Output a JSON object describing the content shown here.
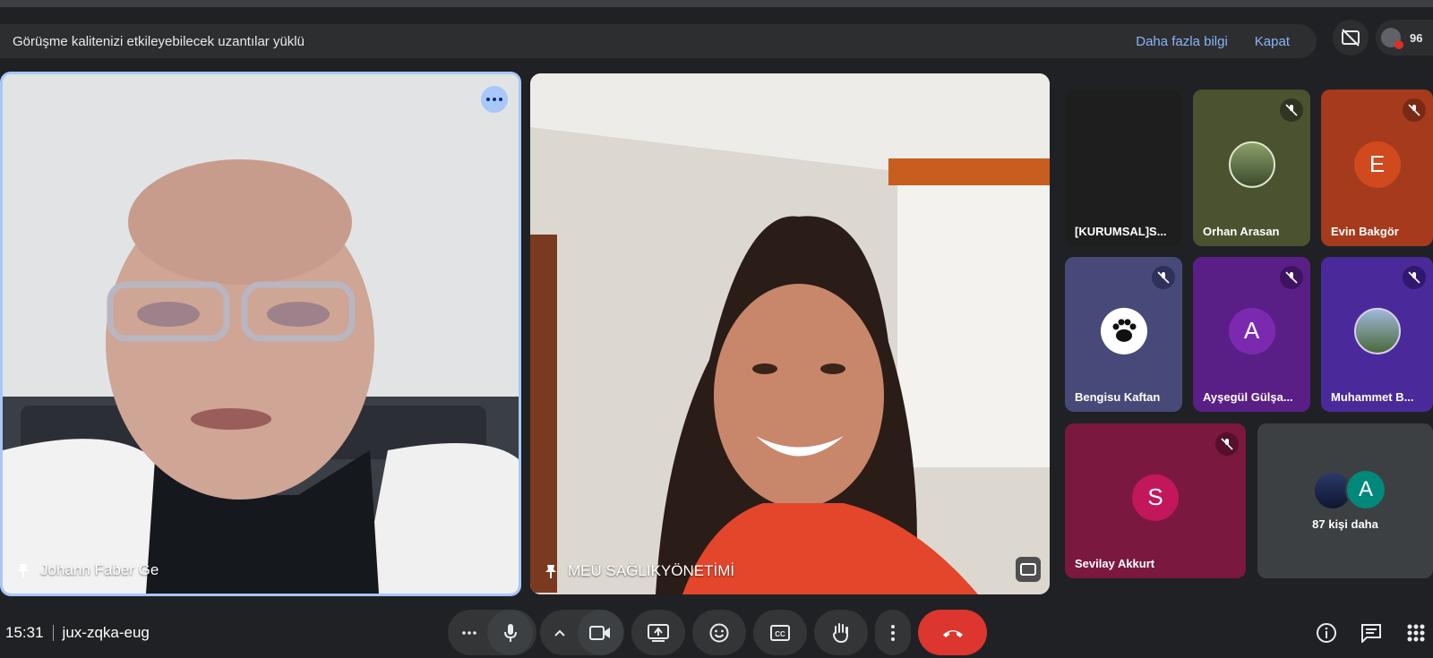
{
  "banner": {
    "message": "Görüşme kalitenizi etkileyebilecek uzantılar yüklü",
    "learn_more": "Daha fazla bilgi",
    "close": "Kapat"
  },
  "participants_count": "96",
  "main_tiles": [
    {
      "name": "Johann Faber Ge"
    },
    {
      "name": "MEÜ SAĞLIKYÖNETİMİ"
    }
  ],
  "grid": [
    {
      "name": "[KURUMSAL]S...",
      "bg": "#1e1e1f",
      "muted": false,
      "avatar": null
    },
    {
      "name": "Orhan Arasan",
      "bg": "#4a5230",
      "muted": true,
      "avatar": "photo"
    },
    {
      "name": "Evin Bakgör",
      "bg": "#a63a1c",
      "muted": true,
      "avatar": "E",
      "avatar_color": "#d04a1e"
    },
    {
      "name": "Bengisu Kaftan",
      "bg": "#474a78",
      "muted": true,
      "avatar": "paw"
    },
    {
      "name": "Ayşegül Gülşa...",
      "bg": "#5a1f86",
      "muted": true,
      "avatar": "A",
      "avatar_color": "#7b2ab0"
    },
    {
      "name": "Muhammet B...",
      "bg": "#4a2a9a",
      "muted": true,
      "avatar": "photo"
    },
    {
      "name": "Sevilay Akkurt",
      "bg": "#7a1840",
      "muted": true,
      "avatar": "S",
      "avatar_color": "#c2185b"
    }
  ],
  "more": {
    "label": "87 kişi daha",
    "avatar_letter": "A"
  },
  "footer": {
    "time": "15:31",
    "meeting_code": "jux-zqka-eug"
  },
  "icons": [
    "more-options-icon",
    "mic-icon",
    "chevron-up-icon",
    "camera-icon",
    "present-icon",
    "emoji-icon",
    "captions-icon",
    "raise-hand-icon",
    "more-vert-icon",
    "end-call-icon",
    "info-icon",
    "chat-icon",
    "activities-icon",
    "pin-icon",
    "fullscreen-icon",
    "mic-off-icon"
  ]
}
